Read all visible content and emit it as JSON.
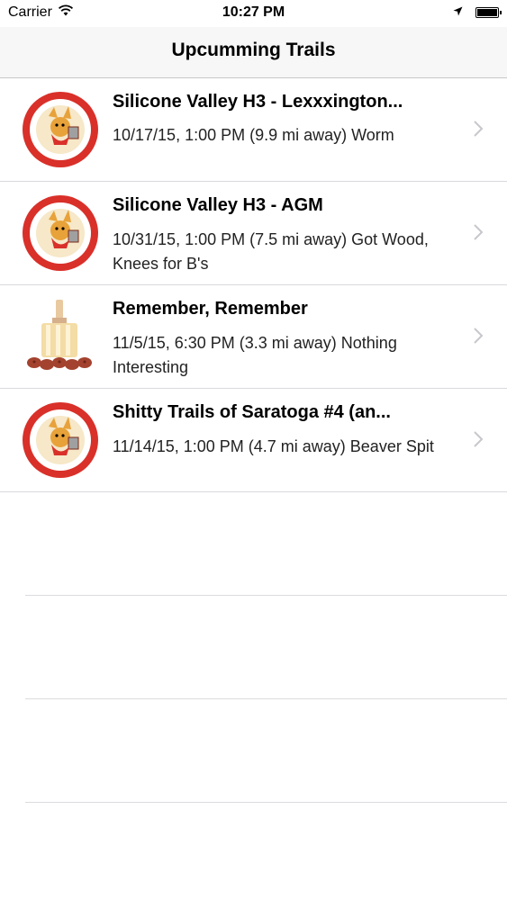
{
  "status_bar": {
    "carrier": "Carrier",
    "time": "10:27 PM",
    "icons": [
      "wifi-icon",
      "location-arrow-icon",
      "battery-icon"
    ]
  },
  "nav": {
    "title": "Upcumming Trails"
  },
  "trails": [
    {
      "title": "Silicone Valley H3 - Lexxxington...",
      "subtitle": "10/17/15, 1:00 PM (9.9 mi away) Worm",
      "icon": "silicon-valley-hhh-logo"
    },
    {
      "title": "Silicone Valley H3 - AGM",
      "subtitle": "10/31/15, 1:00 PM (7.5 mi away) Got Wood, Knees for B's",
      "icon": "silicon-valley-hhh-logo"
    },
    {
      "title": "Remember, Remember",
      "subtitle": "11/5/15, 6:30 PM (3.3 mi away) Nothing Interesting",
      "icon": "torch-icon"
    },
    {
      "title": "Shitty Trails of Saratoga #4 (an...",
      "subtitle": "11/14/15, 1:00 PM (4.7 mi away) Beaver Spit",
      "icon": "silicon-valley-hhh-logo"
    }
  ],
  "colors": {
    "logo_red": "#d9302a",
    "logo_cream": "#f6e8c8",
    "separator": "#d9d9de",
    "nav_bg": "#f7f7f7",
    "chevron": "#c7c7cc"
  }
}
